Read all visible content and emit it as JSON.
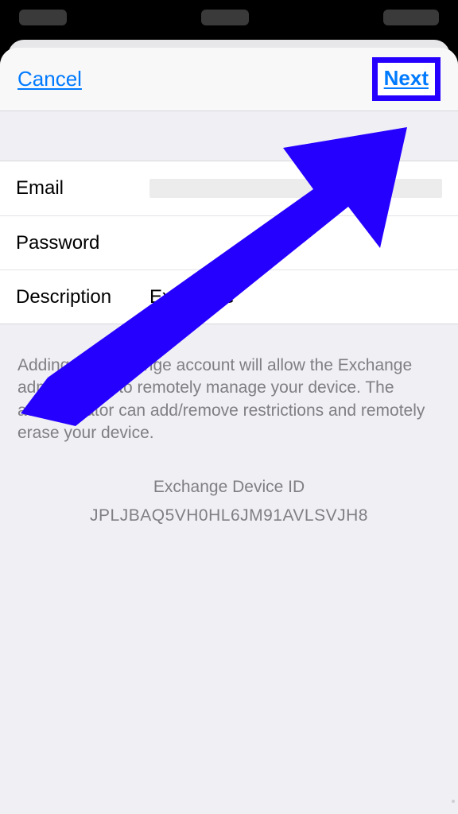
{
  "nav": {
    "cancel_label": "Cancel",
    "next_label": "Next"
  },
  "fields": {
    "email_label": "Email",
    "email_value": "",
    "password_label": "Password",
    "password_value": "",
    "description_label": "Description",
    "description_value": "Exchange"
  },
  "info_text": "Adding an Exchange account will allow the Exchange administrator to remotely manage your device. The administrator can add/remove restrictions and remotely erase your device.",
  "device_id_label": "Exchange Device ID",
  "device_id_value": "JPLJBAQ5VH0HL6JM91AVLSVJH8",
  "annotation": {
    "highlight_color": "#2600ff"
  }
}
